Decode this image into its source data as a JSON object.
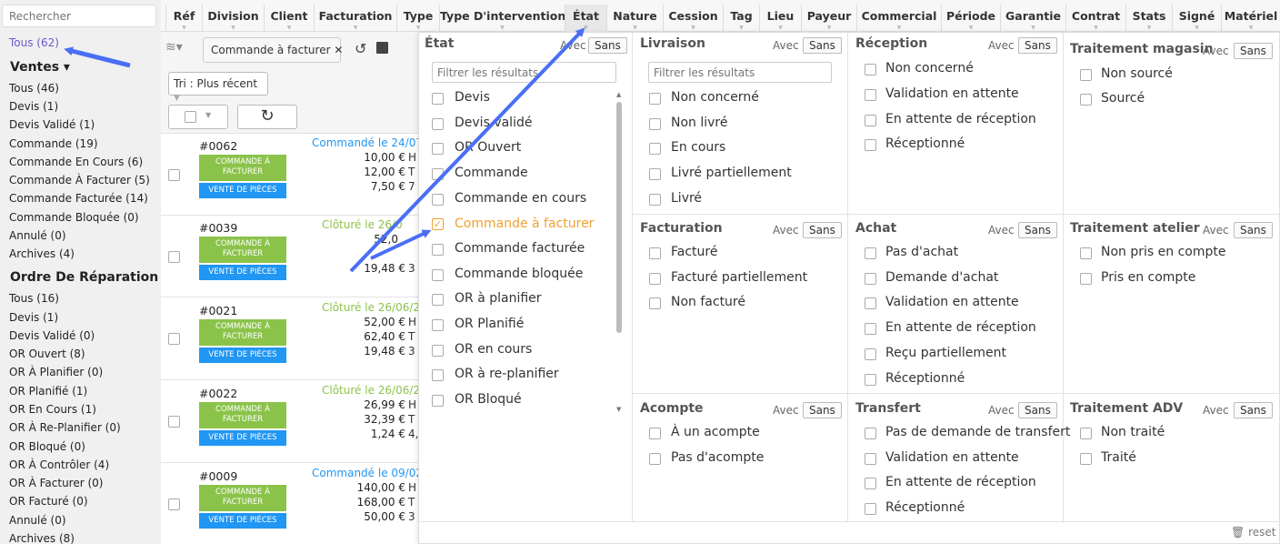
{
  "search": {
    "placeholder": "Rechercher"
  },
  "sidebar": {
    "all": "Tous (62)",
    "ventes_title": "Ventes ▾",
    "ventes": [
      "Tous (46)",
      "Devis (1)",
      "Devis Validé (1)",
      "Commande (19)",
      "Commande En Cours (6)",
      "Commande À Facturer (5)",
      "Commande Facturée (14)",
      "Commande Bloquée (0)",
      "Annulé (0)",
      "Archives (4)"
    ],
    "or_title": "Ordre De Réparation ▾",
    "or": [
      "Tous (16)",
      "Devis (1)",
      "Devis Validé (0)",
      "OR Ouvert (8)",
      "OR À Planifier (0)",
      "OR Planifié (1)",
      "OR En Cours (1)",
      "OR À Re-Planifier (0)",
      "OR Bloqué (0)",
      "OR À Contrôler (4)",
      "OR À Facturer (0)",
      "OR Facturé (0)",
      "Annulé (0)",
      "Archives (8)"
    ]
  },
  "columns": [
    "Réf",
    "Division",
    "Client",
    "Facturation",
    "Type",
    "Type D'intervention",
    "État",
    "Nature",
    "Cession",
    "Tag",
    "Lieu",
    "Payeur",
    "Commercial",
    "Période",
    "Garantie",
    "Contrat",
    "Stats",
    "Signé",
    "Matériel"
  ],
  "toolbar": {
    "chip": "Commande à facturer",
    "sort": "Tri : Plus récent"
  },
  "orders": [
    {
      "num": "#0062",
      "badge1a": "COMMANDE À",
      "badge1b": "FACTURER",
      "badge2": "VENTE DE PIÈCES",
      "status": "Commandé le 24/07",
      "amounts": [
        "10,00 €",
        "12,00 €",
        "7,50 €"
      ],
      "suffix": [
        "H",
        "T",
        "7"
      ]
    },
    {
      "num": "#0039",
      "badge1a": "COMMANDE À",
      "badge1b": "FACTURER",
      "badge2": "VENTE DE PIÈCES",
      "status": "Clôturé le 26/0",
      "amounts": [
        "52,0",
        "",
        "19,48 €"
      ],
      "suffix": [
        "",
        "",
        "3"
      ]
    },
    {
      "num": "#0021",
      "badge1a": "COMMANDE À",
      "badge1b": "FACTURER",
      "badge2": "VENTE DE PIÈCES",
      "status": "Clôturé le 26/06/20",
      "amounts": [
        "52,00 €",
        "62,40 €",
        "19,48 €"
      ],
      "suffix": [
        "H",
        "T",
        "3"
      ]
    },
    {
      "num": "#0022",
      "badge1a": "COMMANDE À",
      "badge1b": "FACTURER",
      "badge2": "VENTE DE PIÈCES",
      "status": "Clôturé le 26/06/20",
      "amounts": [
        "26,99 €",
        "32,39 €",
        "1,24 €"
      ],
      "suffix": [
        "H",
        "T",
        "4,"
      ]
    },
    {
      "num": "#0009",
      "badge1a": "COMMANDE À",
      "badge1b": "FACTURER",
      "badge2": "VENTE DE PIÈCES",
      "status": "Commandé le 09/02",
      "amounts": [
        "140,00 €",
        "168,00 €",
        "50,00 €"
      ],
      "suffix": [
        "H",
        "T",
        "3"
      ]
    }
  ],
  "filters": {
    "avec": "Avec",
    "sans": "Sans",
    "placeholder": "Filtrer les résultats",
    "etat": {
      "title": "État",
      "options": [
        "Devis",
        "Devis validé",
        "OR Ouvert",
        "Commande",
        "Commande en cours",
        "Commande à facturer",
        "Commande facturée",
        "Commande bloquée",
        "OR à planifier",
        "OR Planifié",
        "OR en cours",
        "OR à re-planifier",
        "OR Bloqué"
      ]
    },
    "livraison": {
      "title": "Livraison",
      "options": [
        "Non concerné",
        "Non livré",
        "En cours",
        "Livré partiellement",
        "Livré"
      ]
    },
    "reception": {
      "title": "Réception",
      "options": [
        "Non concerné",
        "Validation en attente",
        "En attente de réception",
        "Réceptionné"
      ]
    },
    "tmagasin": {
      "title": "Traitement magasin",
      "options": [
        "Non sourcé",
        "Sourcé"
      ]
    },
    "facturation": {
      "title": "Facturation",
      "options": [
        "Facturé",
        "Facturé partiellement",
        "Non facturé"
      ]
    },
    "achat": {
      "title": "Achat",
      "options": [
        "Pas d'achat",
        "Demande d'achat",
        "Validation en attente",
        "En attente de réception",
        "Reçu partiellement",
        "Réceptionné"
      ]
    },
    "tatelier": {
      "title": "Traitement atelier",
      "options": [
        "Non pris en compte",
        "Pris en compte"
      ]
    },
    "acompte": {
      "title": "Acompte",
      "options": [
        "À un acompte",
        "Pas d'acompte"
      ]
    },
    "transfert": {
      "title": "Transfert",
      "options": [
        "Pas de demande de transfert",
        "Validation en attente",
        "En attente de réception",
        "Réceptionné"
      ]
    },
    "tadv": {
      "title": "Traitement ADV",
      "options": [
        "Non traité",
        "Traité"
      ]
    },
    "reset": "reset"
  },
  "colors": {
    "accent": "#6a5acd",
    "arrow": "#4a6ef5",
    "green": "#8bc34a",
    "blue": "#2196f3",
    "orange": "#f0a030"
  }
}
